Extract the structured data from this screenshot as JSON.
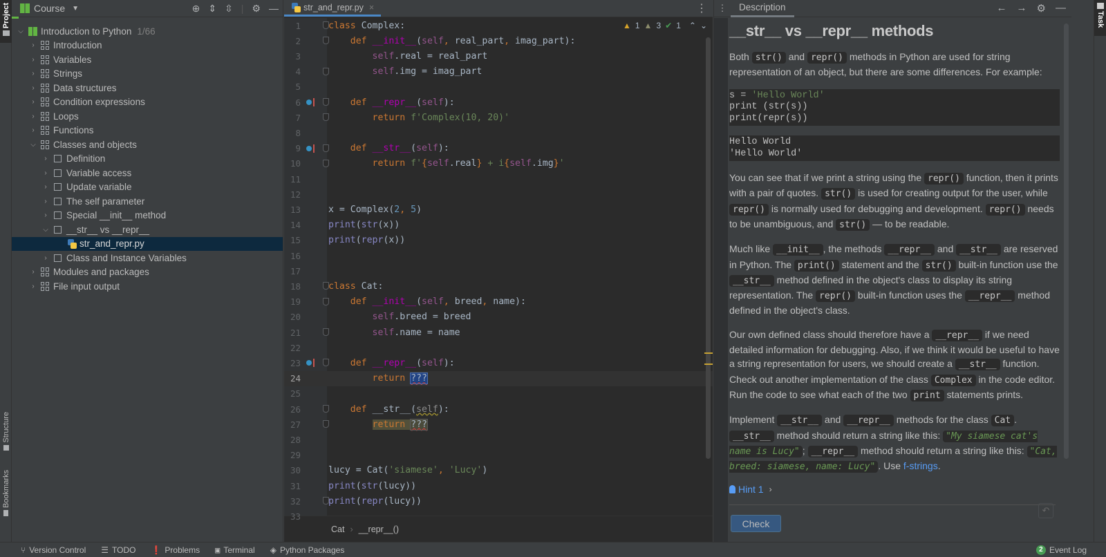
{
  "left_strip": {
    "project": "Project",
    "structure": "Structure",
    "bookmarks": "Bookmarks"
  },
  "project_panel": {
    "title": "Course",
    "course": {
      "name": "Introduction to Python",
      "progress": "1/66"
    },
    "sections": [
      "Introduction",
      "Variables",
      "Strings",
      "Data structures",
      "Condition expressions",
      "Loops",
      "Functions"
    ],
    "expanded_section": "Classes and objects",
    "lessons": [
      "Definition",
      "Variable access",
      "Update variable",
      "The self parameter",
      "Special __init__ method"
    ],
    "expanded_lesson": "__str__ vs __repr__",
    "selected_file": "str_and_repr.py",
    "after_lesson": "Class and Instance Variables",
    "after_sections": [
      "Modules and packages",
      "File input output"
    ]
  },
  "editor": {
    "tab": "str_and_repr.py",
    "inspections": {
      "warnings": "1",
      "weak_warnings": "3",
      "ok": "1"
    },
    "breadcrumb": [
      "Cat",
      "__repr__()"
    ],
    "current_line": 24
  },
  "description": {
    "tab": "Description",
    "title": "__str__ vs __repr__ methods",
    "p1": {
      "a": "Both ",
      "c1": "str()",
      "b": " and ",
      "c2": "repr()",
      "d": " methods in Python are used for string representation of an object, but there are some differences. For example:"
    },
    "code_block": {
      "l1a": "s = ",
      "l1s": "'Hello World'",
      "l2": "print (str(s))",
      "l3": "print(repr(s))"
    },
    "output_block": {
      "l1": "Hello World",
      "l2": "'Hello World'"
    },
    "p2": {
      "a": "You can see that if we print a string using the ",
      "c1": "repr()",
      "b": " function, then it prints with a pair of quotes. ",
      "c2": "str()",
      "d": " is used for creating output for the user, while ",
      "c3": "repr()",
      "e": " is normally used for debugging and development. ",
      "c4": "repr()",
      "f": " needs to be unambiguous, and ",
      "c5": "str()",
      "g": " — to be readable."
    },
    "p3": {
      "a": "Much like ",
      "c1": "__init__",
      "b": ", the methods ",
      "c2": "__repr__",
      "c": " and ",
      "c3": "__str__",
      "d": " are reserved in Python. The ",
      "c4": "print()",
      "e": " statement and the ",
      "c5": "str()",
      "f": " built-in function use the ",
      "c6": "__str__",
      "g": " method defined in the object's class to display its string representation. The ",
      "c7": "repr()",
      "h": " built-in function uses the ",
      "c8": "__repr__",
      "i": " method defined in the object's class."
    },
    "p4": {
      "a": "Our own defined class should therefore have a ",
      "c1": "__repr__",
      "b": " if we need detailed information for debugging. Also, if we think it would be useful to have a string representation for users, we should create a ",
      "c2": "__str__",
      "c": " function. Check out another implementation of the class ",
      "c3": "Complex",
      "d": " in the code editor. Run the code to see what each of the two ",
      "c4": "print",
      "e": " statements prints."
    },
    "p5": {
      "a": "Implement ",
      "c1": "__str__",
      "b": " and ",
      "c2": "__repr__",
      "c": " methods for the class ",
      "c3": "Cat",
      "d": ". ",
      "c4": "__str__",
      "e": " method should return a string like this: ",
      "g1": "\"My siamese cat's name is Lucy\"",
      "f": "; ",
      "c5": "__repr__",
      "g": " method should return a string like this: ",
      "g2": "\"Cat, breed: siamese, name: Lucy\"",
      "h": ". Use ",
      "link": "f-strings",
      "i": "."
    },
    "hint": "Hint 1",
    "check_button": "Check"
  },
  "right_strip": {
    "task": "Task"
  },
  "status_bar": {
    "items": [
      "Version Control",
      "TODO",
      "Problems",
      "Terminal",
      "Python Packages"
    ],
    "event_count": "2",
    "event_log": "Event Log"
  }
}
